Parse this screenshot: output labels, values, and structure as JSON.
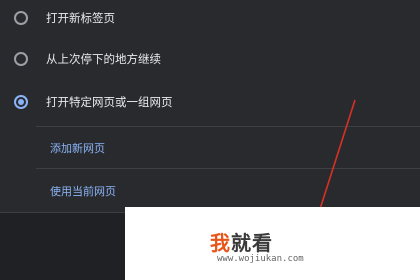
{
  "startup": {
    "options": [
      {
        "label": "打开新标签页",
        "checked": false
      },
      {
        "label": "从上次停下的地方继续",
        "checked": false
      },
      {
        "label": "打开特定网页或一组网页",
        "checked": true
      }
    ],
    "add_page_link": "添加新网页",
    "use_current_link": "使用当前网页"
  },
  "watermark": {
    "title_part1": "我",
    "title_part2": "就看",
    "url": "www.wojiukan.com"
  },
  "colors": {
    "panel_bg": "#292a2d",
    "accent": "#8ab4f8",
    "arrow": "#d93025"
  }
}
